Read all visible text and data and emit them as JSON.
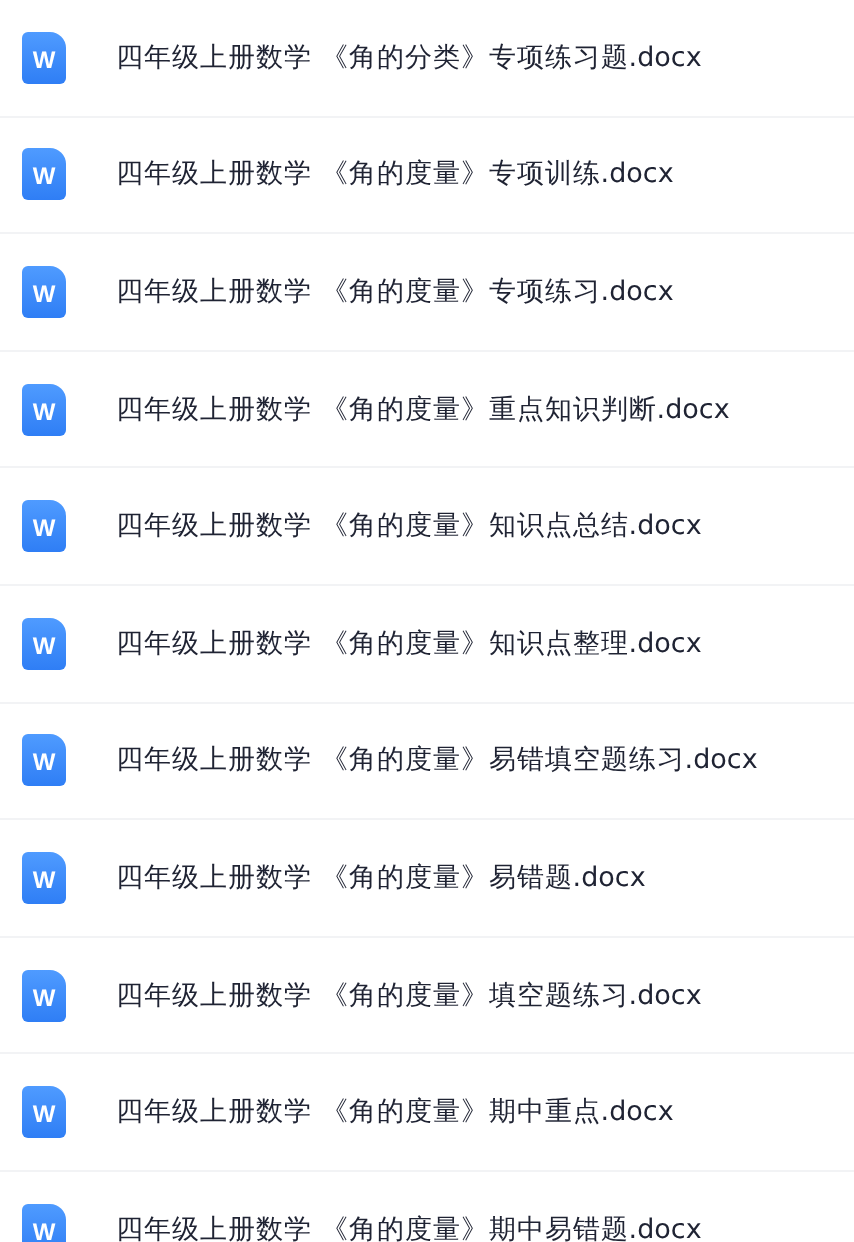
{
  "files": [
    {
      "icon_label": "W",
      "name": "四年级上册数学 《角的分类》专项练习题.docx"
    },
    {
      "icon_label": "W",
      "name": "四年级上册数学 《角的度量》专项训练.docx"
    },
    {
      "icon_label": "W",
      "name": "四年级上册数学 《角的度量》专项练习.docx"
    },
    {
      "icon_label": "W",
      "name": "四年级上册数学 《角的度量》重点知识判断.docx"
    },
    {
      "icon_label": "W",
      "name": "四年级上册数学 《角的度量》知识点总结.docx"
    },
    {
      "icon_label": "W",
      "name": "四年级上册数学 《角的度量》知识点整理.docx"
    },
    {
      "icon_label": "W",
      "name": "四年级上册数学 《角的度量》易错填空题练习.docx"
    },
    {
      "icon_label": "W",
      "name": "四年级上册数学 《角的度量》易错题.docx"
    },
    {
      "icon_label": "W",
      "name": "四年级上册数学 《角的度量》填空题练习.docx"
    },
    {
      "icon_label": "W",
      "name": "四年级上册数学 《角的度量》期中重点.docx"
    },
    {
      "icon_label": "W",
      "name": "四年级上册数学 《角的度量》期中易错题.docx"
    }
  ]
}
